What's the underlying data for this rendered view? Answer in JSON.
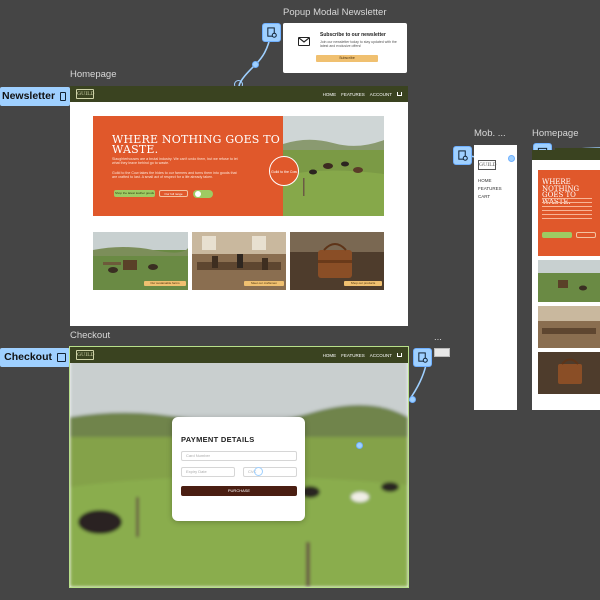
{
  "canvas": {
    "frames": {
      "popup_label": "Popup Modal Newsletter",
      "homepage_label": "Homepage",
      "checkout_label": "Checkout",
      "mobile_label": "Mob. ...",
      "homepage_mobile_label": "Homepage",
      "more_label": "..."
    },
    "tags": {
      "newsletter": "Newsletter",
      "checkout": "Checkout"
    }
  },
  "popup": {
    "title": "Subscribe to our newsletter",
    "body": "Join our newsletter today to stay updated with the latest and exclusive offers!",
    "button": "Subscribe"
  },
  "site": {
    "logo": "GUILD",
    "nav": [
      "HOME",
      "FEATURES",
      "ACCOUNT"
    ]
  },
  "homepage": {
    "headline": "WHERE NOTHING GOES TO WASTE.",
    "para1": "Slaughterhouses are a brutal industry. We can't undo them, but we refuse to let what they leave behind go to waste.",
    "para2": "Guild to the Cow takes the hides to our farmers and turns them into goods that are crafted to last. A small act of respect for a life already taken.",
    "btn_primary": "Shop the latest leather goods",
    "btn_secondary": "Our full range",
    "circle_text": "Guild to the Cow",
    "captions": [
      "Our sustainable farms",
      "Meet our craftsmen",
      "Shop our products"
    ]
  },
  "mobile_menu": {
    "items": [
      "HOME",
      "FEATURES",
      "CART"
    ]
  },
  "mobile_home": {
    "headline": "WHERE NOTHING GOES TO WASTE."
  },
  "checkout": {
    "title": "PAYMENT DETAILS",
    "card_placeholder": "Card Number",
    "expiry_placeholder": "Expiry Date",
    "cvc_placeholder": "CVC",
    "button": "PURCHASE"
  }
}
